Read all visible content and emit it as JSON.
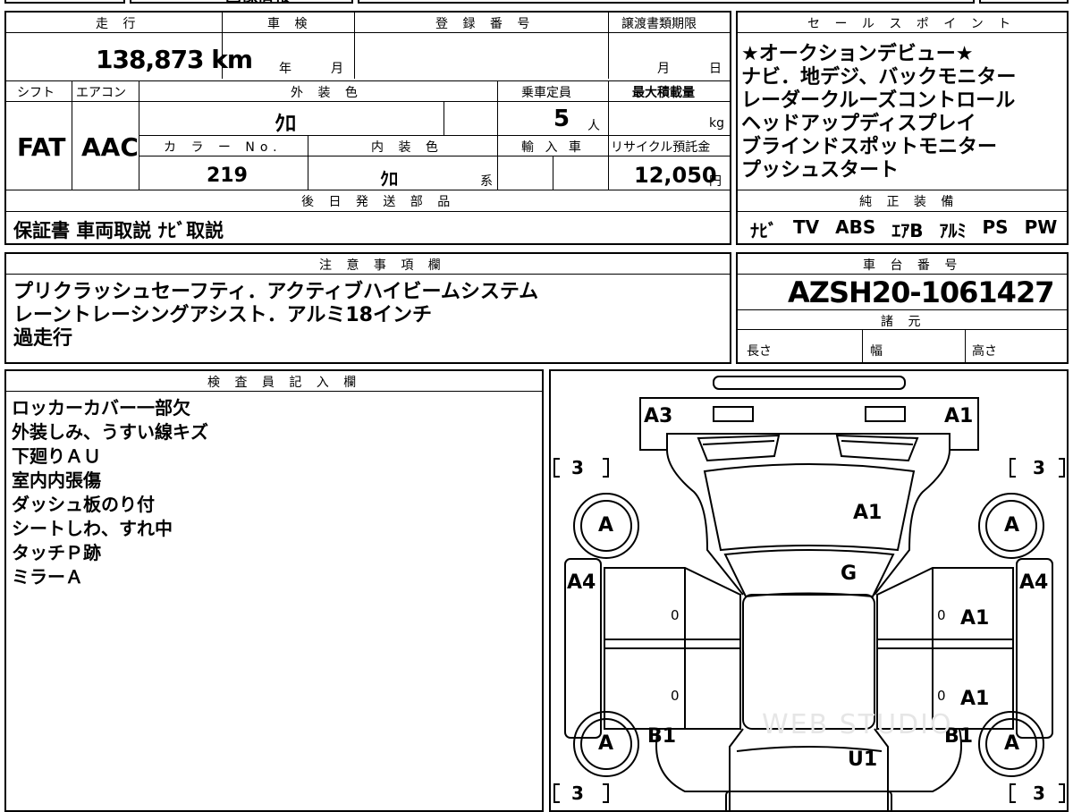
{
  "top_strip": {
    "fragment": "画像情報"
  },
  "mileage": {
    "header": "走 行",
    "value": "138,873 km"
  },
  "inspection": {
    "header": "車 検",
    "year": "年",
    "month": "月"
  },
  "registration": {
    "header": "登 録 番 号",
    "value": ""
  },
  "transfer_deadline": {
    "header": "譲渡書類期限",
    "month": "月",
    "day": "日"
  },
  "shift": {
    "header": "シフト",
    "value": "FAT"
  },
  "aircon": {
    "header": "エアコン",
    "value": "AAC"
  },
  "exterior_color": {
    "header": "外 装 色",
    "value": "ｸﾛ"
  },
  "capacity": {
    "header": "乗車定員",
    "value": "5",
    "unit": "人"
  },
  "max_load": {
    "header": "最大積載量",
    "unit": "kg"
  },
  "color_no": {
    "header": "カ ラ ー No.",
    "value": "219"
  },
  "interior_color": {
    "header": "内 装 色",
    "value": "ｸﾛ",
    "suffix": "系"
  },
  "import": {
    "header": "輸 入 車"
  },
  "recycle": {
    "header": "リサイクル預託金",
    "value": "12,050",
    "unit": "円"
  },
  "later_parts": {
    "header": "後 日 発 送 部 品",
    "value": "保証書 車両取説 ﾅﾋﾞ取説"
  },
  "sales_points": {
    "header": "セ ー ル ス ポ イ ン ト",
    "items": [
      "★オークションデビュー★",
      "ナビ．地デジ、バックモニター",
      "レーダークルーズコントロール",
      "ヘッドアップディスプレイ",
      "ブラインドスポットモニター",
      "プッシュスタート"
    ]
  },
  "genuine_equipment": {
    "header": "純 正 装 備",
    "items": [
      "ﾅﾋﾞ",
      "TV",
      "ABS",
      "ｴｱB",
      "ｱﾙﾐ",
      "PS",
      "PW"
    ]
  },
  "notes": {
    "header": "注 意 事 項 欄",
    "lines": [
      "プリクラッシュセーフティ．アクティブハイビームシステム",
      "レーントレーシングアシスト．アルミ18インチ",
      "過走行"
    ]
  },
  "chassis": {
    "header": "車 台 番 号",
    "value": "AZSH20-1061427"
  },
  "specs": {
    "header": "諸 元",
    "length": "長さ",
    "width": "幅",
    "height": "高さ"
  },
  "inspector": {
    "header": "検 査 員 記 入 欄",
    "lines": [
      "ロッカーカバー一部欠",
      "外装しみ、うすい線キズ",
      "下廻りＡＵ",
      "室内内張傷",
      "ダッシュ板のり付",
      "シートしわ、すれ中",
      "タッチＰ跡",
      "ミラーＡ"
    ]
  },
  "diagram": {
    "labels": {
      "front_left": "A3",
      "front_right": "A1",
      "hood": "A1",
      "windshield": "G",
      "left_side": "A4",
      "right_side": "A4",
      "right_front_door": "A1",
      "right_rear_door": "A1",
      "left_rear": "B1",
      "right_rear": "B1",
      "roof": "U1",
      "wheel": "A",
      "tire_tread": "3",
      "zero": "0"
    },
    "watermark": "WEB STUDIO"
  }
}
